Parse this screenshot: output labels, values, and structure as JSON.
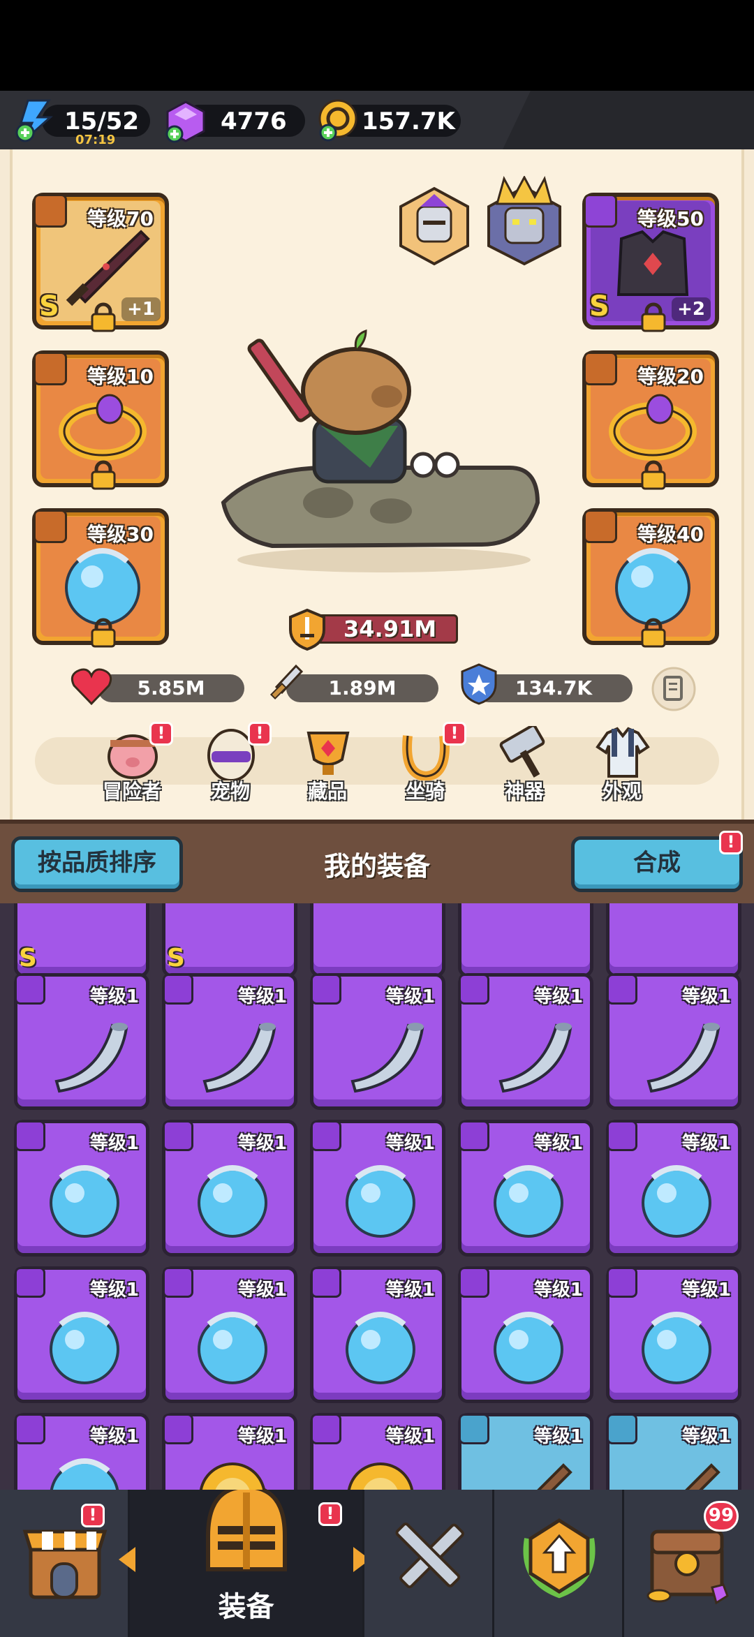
{
  "resources": {
    "energy": {
      "value": "15/52",
      "timer": "07:19",
      "icon": "lightning-plus-icon"
    },
    "gems": {
      "value": "4776",
      "icon": "purple-gem-plus-icon"
    },
    "gold": {
      "value": "157.7K",
      "icon": "gold-coin-plus-icon"
    }
  },
  "hero": {
    "left_slots": [
      {
        "level": "等级70",
        "grade": "S",
        "plus": "+1",
        "type": "weapon",
        "rarity": "gold"
      },
      {
        "level": "等级10",
        "type": "ring",
        "rarity": "orange"
      },
      {
        "level": "等级30",
        "type": "necklace",
        "rarity": "orange"
      }
    ],
    "right_slots": [
      {
        "level": "等级50",
        "grade": "S",
        "plus": "+2",
        "type": "armor",
        "rarity": "purple"
      },
      {
        "level": "等级20",
        "type": "ring",
        "rarity": "orange"
      },
      {
        "level": "等级40",
        "type": "necklace",
        "rarity": "orange"
      }
    ],
    "power": "34.91M",
    "stats": {
      "hp": "5.85M",
      "attack": "1.89M",
      "defense": "134.7K"
    }
  },
  "functions": [
    {
      "label": "冒险者",
      "alert": true,
      "icon": "adventurer-pig-icon"
    },
    {
      "label": "宠物",
      "alert": true,
      "icon": "pet-egg-icon"
    },
    {
      "label": "藏品",
      "alert": false,
      "icon": "collection-trophy-icon"
    },
    {
      "label": "坐骑",
      "alert": true,
      "icon": "mount-horseshoe-icon"
    },
    {
      "label": "神器",
      "alert": false,
      "icon": "artifact-hammer-icon"
    },
    {
      "label": "外观",
      "alert": false,
      "icon": "appearance-clothes-icon"
    }
  ],
  "equipment": {
    "title": "我的装备",
    "sort_button": "按品质排序",
    "merge_button": "合成",
    "merge_alert": "!",
    "rows": [
      [
        {
          "level": "等级1",
          "item": "horn"
        },
        {
          "level": "等级1",
          "item": "horn"
        },
        {
          "level": "等级1",
          "item": "horn"
        },
        {
          "level": "等级1",
          "item": "horn"
        },
        {
          "level": "等级1",
          "item": "horn"
        }
      ],
      [
        {
          "level": "等级1",
          "item": "orb"
        },
        {
          "level": "等级1",
          "item": "orb"
        },
        {
          "level": "等级1",
          "item": "orb"
        },
        {
          "level": "等级1",
          "item": "orb"
        },
        {
          "level": "等级1",
          "item": "orb"
        }
      ],
      [
        {
          "level": "等级1",
          "item": "orb"
        },
        {
          "level": "等级1",
          "item": "orb"
        },
        {
          "level": "等级1",
          "item": "orb"
        },
        {
          "level": "等级1",
          "item": "orb"
        },
        {
          "level": "等级1",
          "item": "orb"
        }
      ],
      [
        {
          "level": "等级1",
          "item": "orb"
        },
        {
          "level": "等级1",
          "item": "sun"
        },
        {
          "level": "等级1",
          "item": "sun"
        },
        {
          "level": "等级1",
          "item": "sword"
        },
        {
          "level": "等级1",
          "item": "sword"
        }
      ]
    ],
    "top_partial_grades": [
      "S",
      "S"
    ]
  },
  "nav": {
    "active_label": "装备",
    "alert": "!",
    "chest_count": "99"
  },
  "colors": {
    "purple": "#a357e8",
    "orange": "#f2a531",
    "blue": "#6fc0e2",
    "alert": "#e9344e"
  }
}
